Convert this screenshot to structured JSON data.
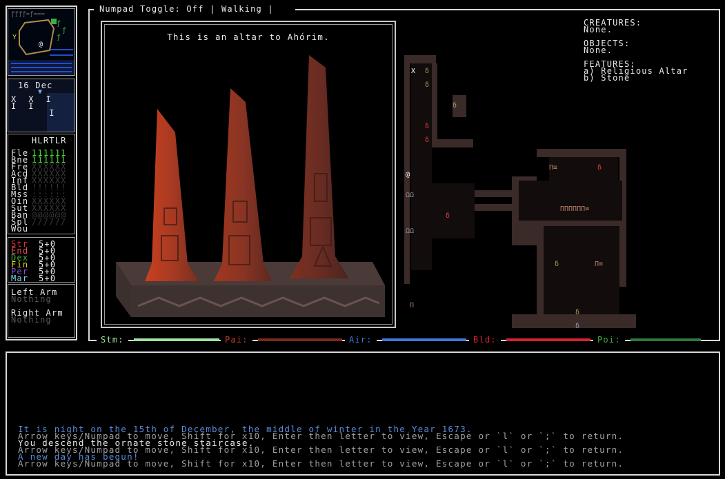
{
  "header": {
    "numpad_toggle": "Numpad Toggle: Off",
    "mode": "Walking",
    "separator": "|"
  },
  "sidebar": {
    "minimap": {
      "glyph_rows": [
        "ƒƒƒƒ≈ƒ≈≈≈",
        "≈  ˜  ƒ≈≈",
        "Y     ƒƒ≈",
        "   @  ≈≈≈",
        "≈≈≈≈≈≈≈≈≈"
      ]
    },
    "calendar": {
      "date": "16 Dec",
      "marker": "▼",
      "row1": "X  X  I",
      "row2": "I  I",
      "row3": "   I"
    },
    "wounds": {
      "header": "HLRTLR",
      "rows": [
        {
          "label": "Fle",
          "value": "111111",
          "color": "#4fdc3a"
        },
        {
          "label": "Bne",
          "value": "111111",
          "color": "#4fdc3a"
        },
        {
          "label": "Fre",
          "value": "XXXXXX",
          "color": "#3a3a3a"
        },
        {
          "label": "Acd",
          "value": "XXXXXX",
          "color": "#3a3a3a"
        },
        {
          "label": "Inf",
          "value": "XXXXXX",
          "color": "#3a3a3a"
        },
        {
          "label": "Bld",
          "value": "!!!!!!",
          "color": "#3a3a3a"
        },
        {
          "label": "Mss",
          "value": "::::::",
          "color": "#3a3a3a"
        },
        {
          "label": "Oin",
          "value": "XXXXXX",
          "color": "#3a3a3a"
        },
        {
          "label": "Sut",
          "value": "XXXXXX",
          "color": "#3a3a3a"
        },
        {
          "label": "Ban",
          "value": "@@@@@@",
          "color": "#3a3a3a"
        },
        {
          "label": "Spl",
          "value": "//////",
          "color": "#3a3a3a"
        },
        {
          "label": "Wou",
          "value": "",
          "color": "#3a3a3a"
        }
      ]
    },
    "attributes": [
      {
        "label": "Str",
        "value": "5+0",
        "color": "#e83030"
      },
      {
        "label": "End",
        "value": "5+0",
        "color": "#e85050"
      },
      {
        "label": "Dex",
        "value": "5+0",
        "color": "#3fae3f"
      },
      {
        "label": "Fin",
        "value": "5+0",
        "color": "#d8d820"
      },
      {
        "label": "Per",
        "value": "5+0",
        "color": "#8a4fe0"
      },
      {
        "label": "Mar",
        "value": "5+0",
        "color": "#7fd8e8"
      }
    ],
    "equipment": {
      "left_label": "Left Arm",
      "left_value": "Nothing",
      "right_label": "Right Arm",
      "right_value": "Nothing"
    }
  },
  "viewer": {
    "caption": "This is an altar to Ahórim."
  },
  "info": {
    "creatures_label": "CREATURES:",
    "creatures_value": "None.",
    "objects_label": "OBJECTS:",
    "objects_value": "None.",
    "features_label": "FEATURES:",
    "features": [
      "a) Religious Altar",
      "b) Stone"
    ]
  },
  "status_bars": [
    {
      "label": "Stm:",
      "color": "#9fe39f",
      "label_color": "#9fe39f"
    },
    {
      "label": "Pai:",
      "color": "#7a2a1a",
      "label_color": "#c0402a"
    },
    {
      "label": "Air:",
      "color": "#3f78d8",
      "label_color": "#3f78d8"
    },
    {
      "label": "Bld:",
      "color": "#d82030",
      "label_color": "#d82030"
    },
    {
      "label": "Poi:",
      "color": "#2a7a3a",
      "label_color": "#3fae3f"
    }
  ],
  "log": [
    {
      "text": "It is night on the 15th of December, the middle of winter in the Year 1673.",
      "color": "#5a8ad8"
    },
    {
      "text": "Arrow keys/Numpad to move, Shift for x10, Enter then letter to view, Escape or `l` or `;` to return.",
      "color": "#a0a0a0"
    },
    {
      "text": "You descend the ornate stone staircase.",
      "color": "#e8e8e8"
    },
    {
      "text": "Arrow keys/Numpad to move, Shift for x10, Enter then letter to view, Escape or `l` or `;` to return.",
      "color": "#a0a0a0"
    },
    {
      "text": "A new day has begun!",
      "color": "#5a8ad8"
    },
    {
      "text": "Arrow keys/Numpad to move, Shift for x10, Enter then letter to view, Escape or `l` or `;` to return.",
      "color": "#a0a0a0"
    }
  ]
}
